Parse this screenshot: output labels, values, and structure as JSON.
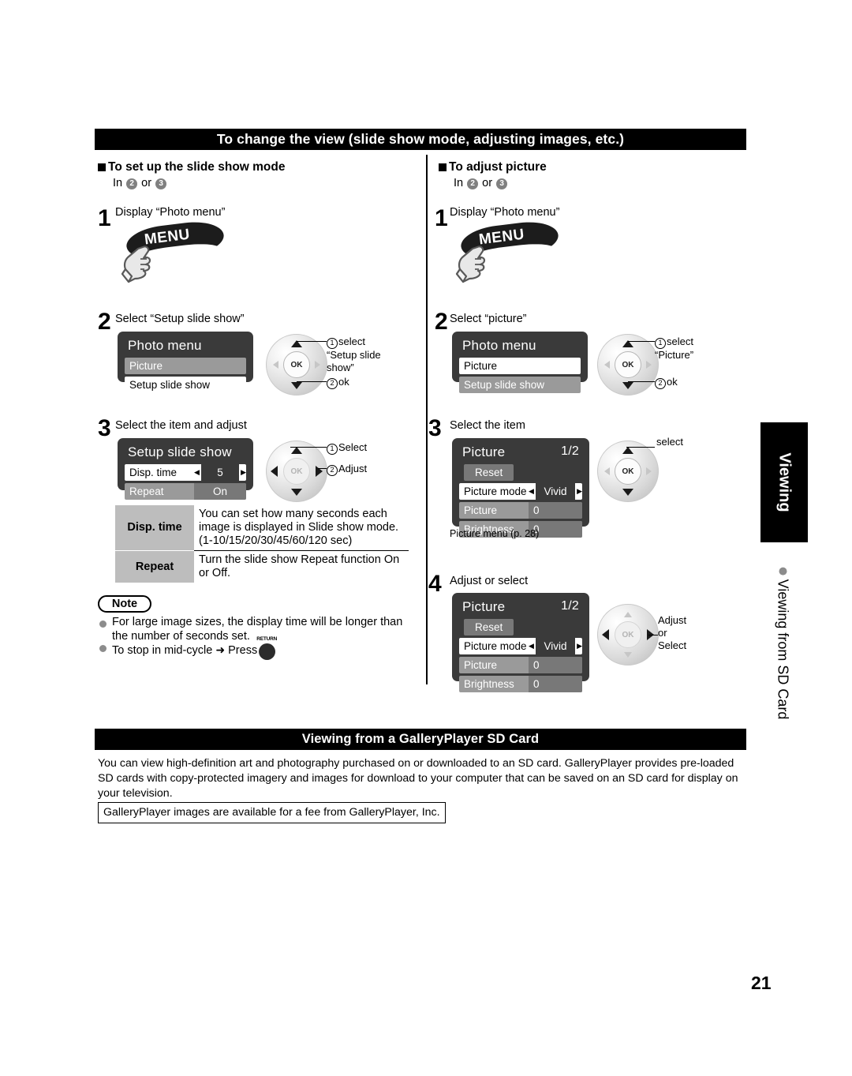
{
  "sections": {
    "top_bar": "To change the view (slide show mode, adjusting images, etc.)",
    "bottom_bar": "Viewing from a GalleryPlayer SD Card"
  },
  "left_column": {
    "heading": "To set up the slide show mode",
    "in_line": {
      "prefix": "In",
      "first": "2",
      "conj": "or",
      "second": "3"
    },
    "step1": {
      "number": "1",
      "caption": "Display “Photo menu”",
      "button_label": "MENU"
    },
    "step2": {
      "number": "2",
      "caption": "Select “Setup slide show”",
      "menu_title": "Photo menu",
      "items": [
        {
          "label": "Picture",
          "selected": false
        },
        {
          "label": "Setup slide show",
          "selected": true
        }
      ],
      "callout1": {
        "marker": "1",
        "text": "select",
        "text2": "“Setup slide",
        "text3": "show”"
      },
      "callout2": {
        "marker": "2",
        "text": "ok"
      },
      "ok_label": "OK"
    },
    "step3": {
      "number": "3",
      "caption": "Select the item and adjust",
      "menu_title": "Setup slide show",
      "rows": [
        {
          "label": "Disp. time",
          "value": "5",
          "selected": true
        },
        {
          "label": "Repeat",
          "value": "On",
          "selected": false
        }
      ],
      "callout1": {
        "marker": "1",
        "text": "Select"
      },
      "callout2": {
        "marker": "2",
        "text": "Adjust"
      },
      "ok_label": "OK"
    },
    "desc_table": [
      {
        "key": "Disp. time",
        "value": "You can set how many seconds each image is displayed in Slide show mode. (1-10/15/20/30/45/60/120 sec)"
      },
      {
        "key": "Repeat",
        "value": "Turn the slide show Repeat function On or Off."
      }
    ],
    "note": {
      "title": "Note",
      "items": [
        "For large image sizes, the display time will be longer than the number of seconds set.",
        "To stop in mid-cycle"
      ],
      "item2_press": "Press",
      "return_key_label": "RETURN",
      "arrow": "➜"
    }
  },
  "right_column": {
    "heading": "To adjust picture",
    "in_line": {
      "prefix": "In",
      "first": "2",
      "conj": "or",
      "second": "3"
    },
    "step1": {
      "number": "1",
      "caption": "Display “Photo menu”",
      "button_label": "MENU"
    },
    "step2": {
      "number": "2",
      "caption": "Select “picture”",
      "menu_title": "Photo menu",
      "items": [
        {
          "label": "Picture",
          "selected": true
        },
        {
          "label": "Setup slide show",
          "selected": false
        }
      ],
      "callout1": {
        "marker": "1",
        "text": "select",
        "text2": "“Picture”"
      },
      "callout2": {
        "marker": "2",
        "text": "ok"
      },
      "ok_label": "OK"
    },
    "step3": {
      "number": "3",
      "caption": "Select the item",
      "menu_title": "Picture",
      "page_indicator": "1/2",
      "reset_label": "Reset",
      "rows": [
        {
          "label": "Picture mode",
          "value": "Vivid",
          "selected": true
        },
        {
          "label": "Picture",
          "value": "0",
          "selected": false
        },
        {
          "label": "Brightness",
          "value": "0",
          "selected": false
        }
      ],
      "footnote": "Picture menu (p. 28)",
      "callout": "select",
      "ok_label": "OK"
    },
    "step4": {
      "number": "4",
      "caption": "Adjust or select",
      "menu_title": "Picture",
      "page_indicator": "1/2",
      "reset_label": "Reset",
      "rows": [
        {
          "label": "Picture mode",
          "value": "Vivid",
          "selected": true
        },
        {
          "label": "Picture",
          "value": "0",
          "selected": false
        },
        {
          "label": "Brightness",
          "value": "0",
          "selected": false
        }
      ],
      "callout_line1": "Adjust",
      "callout_line2": "or",
      "callout_line3": "Select",
      "ok_label": "OK"
    }
  },
  "bottom": {
    "body": "You can view high-definition art and photography purchased on or downloaded to an SD card. GalleryPlayer provides pre-loaded SD cards with copy-protected imagery and images for download to your computer that can be saved on an SD card for display on your television.",
    "fee_box": "GalleryPlayer images are available for a fee from GalleryPlayer, Inc."
  },
  "side": {
    "tab": "Viewing",
    "label": "Viewing from SD Card"
  },
  "page_number": "21"
}
